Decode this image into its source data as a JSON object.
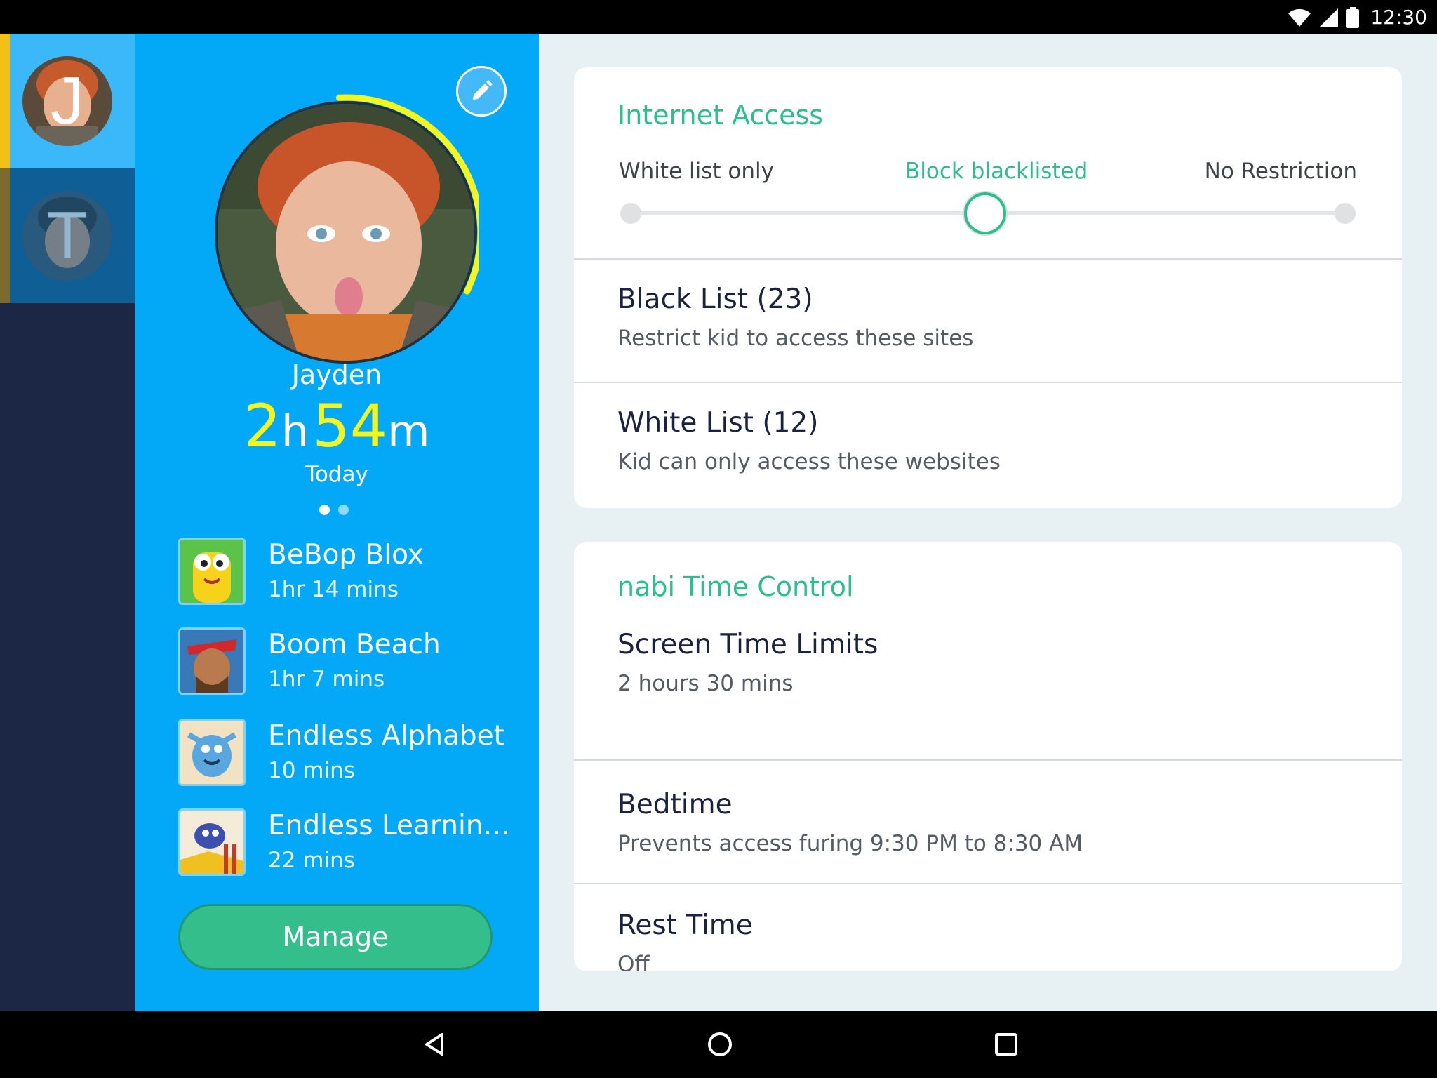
{
  "status_bar": {
    "time": "12:30",
    "icons": [
      "wifi-icon",
      "signal-icon",
      "battery-icon"
    ]
  },
  "profiles": [
    {
      "initial": "J",
      "active": true
    },
    {
      "initial": "T",
      "active": false
    }
  ],
  "kid": {
    "name": "Jayden",
    "usage_hours": "2",
    "usage_hours_unit": "h",
    "usage_minutes": "54",
    "usage_minutes_unit": "m",
    "usage_label": "Today",
    "usage_ring_fraction": 0.33,
    "page_dots": 2,
    "page_active": 1
  },
  "apps": [
    {
      "name": "BeBop Blox",
      "time": "1hr 14 mins"
    },
    {
      "name": "Boom Beach",
      "time": "1hr 7 mins"
    },
    {
      "name": "Endless Alphabet",
      "time": "10 mins"
    },
    {
      "name": "Endless Learnin…",
      "time": "22 mins"
    }
  ],
  "manage_label": "Manage",
  "internet_access": {
    "title": "Internet Access",
    "options": [
      "White list only",
      "Block blacklisted",
      "No Restriction"
    ],
    "selected_index": 1,
    "black_list": {
      "title": "Black List (23)",
      "subtitle": "Restrict kid to access these sites"
    },
    "white_list": {
      "title": "White List (12)",
      "subtitle": "Kid can only access these websites"
    }
  },
  "time_control": {
    "title": "nabi Time Control",
    "screen_time": {
      "title": "Screen Time Limits",
      "subtitle": "2 hours 30 mins"
    },
    "bedtime": {
      "title": "Bedtime",
      "subtitle": "Prevents access furing 9:30 PM to 8:30 AM"
    },
    "rest_time": {
      "title": "Rest Time",
      "subtitle": "Off"
    }
  },
  "colors": {
    "accent_green": "#2cbf8c",
    "panel_blue": "#03a9f6",
    "rail_navy": "#1c2746",
    "usage_yellow": "#f2f520"
  }
}
